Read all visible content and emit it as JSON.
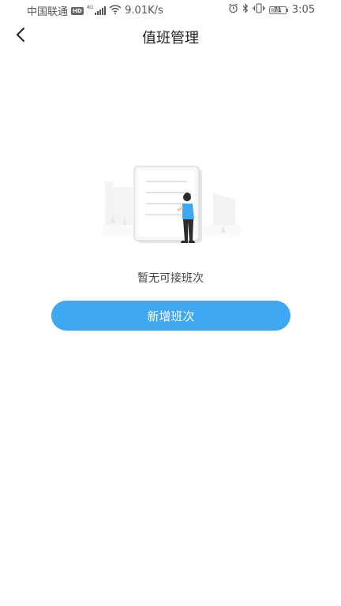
{
  "status_bar": {
    "carrier": "中国联通",
    "hd": "HD",
    "network": "4G",
    "speed": "9.01K/s",
    "battery_level": "71",
    "battery_fraction": 0.71,
    "time": "3:05"
  },
  "header": {
    "title": "值班管理",
    "back_icon": "chevron-left-icon"
  },
  "empty_state": {
    "message": "暂无可接班次",
    "illustration": "empty-document-illustration"
  },
  "actions": {
    "add_shift_label": "新增班次"
  },
  "colors": {
    "accent": "#3ea8f3",
    "background": "#ffffff"
  }
}
